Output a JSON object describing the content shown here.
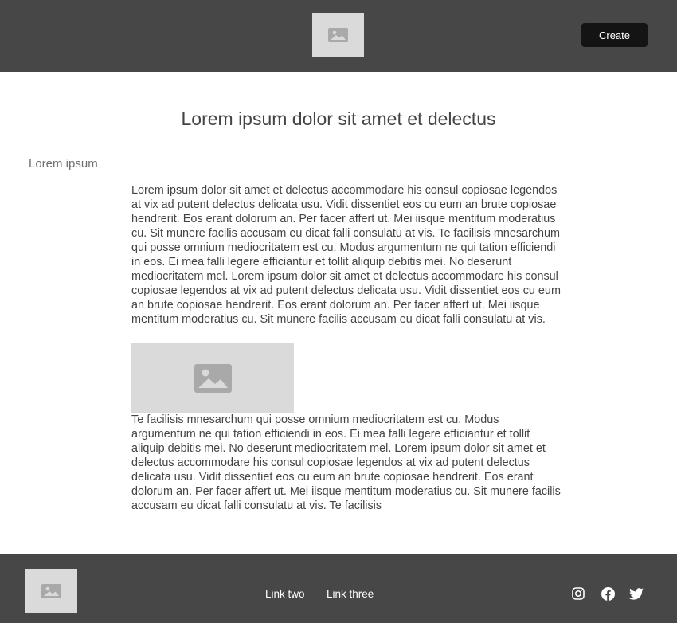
{
  "header": {
    "logo_icon": "image-placeholder-icon",
    "create_label": "Create"
  },
  "main": {
    "title": "Lorem ipsum dolor sit amet et delectus",
    "subtitle": "Lorem ipsum",
    "paragraph1": "Lorem ipsum dolor sit amet et delectus accommodare his consul copiosae legendos at vix ad putent delectus delicata usu. Vidit dissentiet eos cu eum an brute copiosae hendrerit. Eos erant dolorum an. Per facer affert ut. Mei iisque mentitum moderatius cu. Sit munere facilis accusam eu dicat falli consulatu at vis. Te facilisis mnesarchum qui posse omnium mediocritatem est cu. Modus argumentum ne qui tation efficiendi in eos. Ei mea falli legere efficiantur et tollit aliquip debitis mei. No deserunt mediocritatem mel. Lorem ipsum dolor sit amet et delectus accommodare his consul copiosae legendos at vix ad putent delectus delicata usu. Vidit dissentiet eos cu eum an brute copiosae hendrerit. Eos erant dolorum an. Per facer affert ut. Mei iisque mentitum moderatius cu. Sit munere facilis accusam eu dicat falli consulatu at vis.",
    "content_image_icon": "image-placeholder-icon",
    "paragraph2": "Te facilisis mnesarchum qui posse omnium mediocritatem est cu. Modus argumentum ne qui tation efficiendi in eos. Ei mea falli legere efficiantur et tollit aliquip debitis mei. No deserunt mediocritatem mel. Lorem ipsum dolor sit amet et delectus accommodare his consul copiosae legendos at vix ad putent delectus delicata usu. Vidit dissentiet eos cu eum an brute copiosae hendrerit. Eos erant dolorum an. Per facer affert ut. Mei iisque mentitum moderatius cu. Sit munere facilis accusam eu dicat falli consulatu at vis. Te facilisis"
  },
  "footer": {
    "logo_icon": "image-placeholder-icon",
    "links": [
      {
        "label": "Link two"
      },
      {
        "label": "Link three"
      }
    ],
    "social": [
      "instagram-icon",
      "facebook-icon",
      "twitter-icon"
    ]
  },
  "colors": {
    "header_bg": "#474747",
    "button_bg": "#141414",
    "placeholder_bg": "#dadada",
    "placeholder_icon": "#a9a9a9"
  }
}
